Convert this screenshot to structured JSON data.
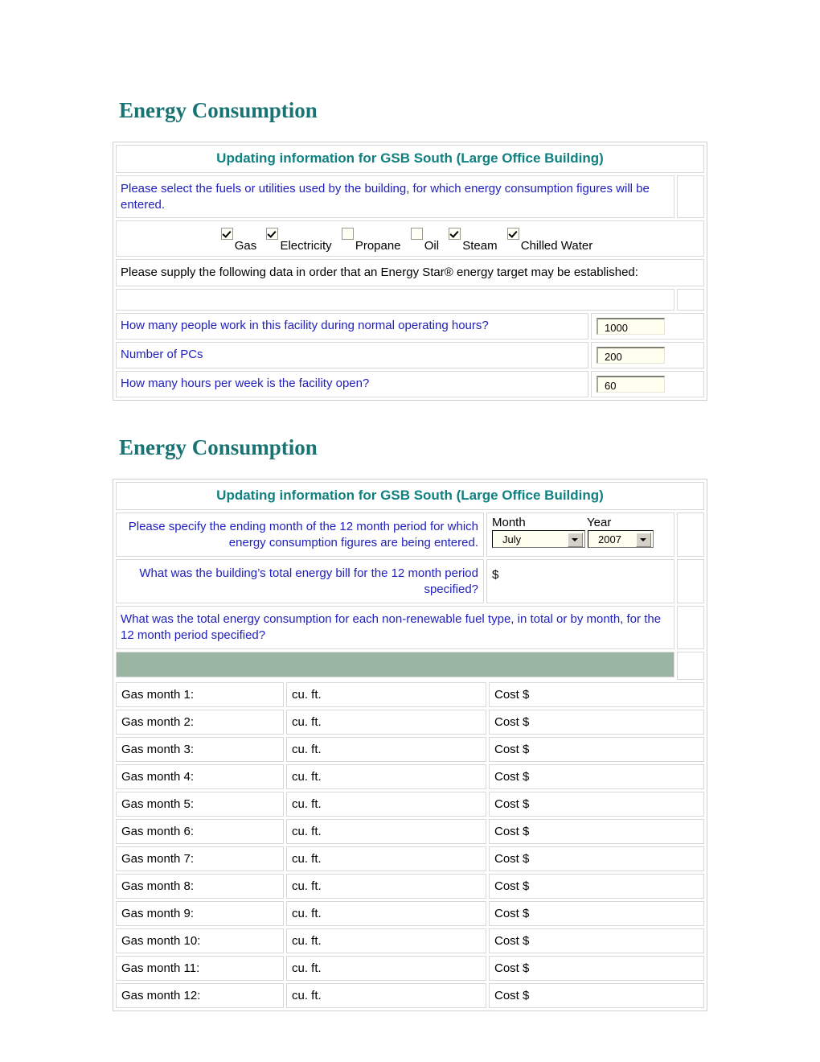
{
  "colors": {
    "heading_teal": "#1a7373",
    "panel_title_teal": "#118080",
    "prompt_blue": "#2020c0",
    "green_bar": "#9ab5a2",
    "input_bg": "#fffff0"
  },
  "section1": {
    "heading": "Energy Consumption",
    "panel_title": "Updating information for GSB South (Large Office Building)",
    "fuel_prompt": "Please select the fuels or utilities used by the building, for which energy consumption figures will be entered.",
    "fuels": [
      {
        "label": "Gas",
        "checked": true
      },
      {
        "label": "Electricity",
        "checked": true
      },
      {
        "label": "Propane",
        "checked": false
      },
      {
        "label": "Oil",
        "checked": false
      },
      {
        "label": "Steam",
        "checked": true
      },
      {
        "label": "Chilled Water",
        "checked": true
      }
    ],
    "supply_note": "Please supply the following data in order that an Energy Star® energy target may be established:",
    "fields": [
      {
        "label": "How many people work in this facility during normal operating hours?",
        "value": "1000"
      },
      {
        "label": "Number of PCs",
        "value": "200"
      },
      {
        "label": "How many hours per week is the facility open?",
        "value": "60"
      }
    ]
  },
  "section2": {
    "heading": "Energy Consumption",
    "panel_title": "Updating information for GSB South (Large Office Building)",
    "period_question": "Please specify the ending month of the 12 month period for which energy consumption figures are being entered.",
    "month_label": "Month",
    "year_label": "Year",
    "month_value": "July",
    "year_value": "2007",
    "bill_question": "What was the building’s total energy bill for the 12 month period specified?",
    "bill_prefix": "$",
    "bill_value": "",
    "consumption_note": "What was the total energy consumption for each non-renewable fuel type, in total or by month, for the 12 month period specified?",
    "gas_rows": [
      {
        "month": "Gas month 1:",
        "unit": "cu. ft.",
        "cost": "Cost $"
      },
      {
        "month": "Gas month 2:",
        "unit": "cu. ft.",
        "cost": "Cost $"
      },
      {
        "month": "Gas month 3:",
        "unit": "cu. ft.",
        "cost": "Cost $"
      },
      {
        "month": "Gas month 4:",
        "unit": "cu. ft.",
        "cost": "Cost $"
      },
      {
        "month": "Gas month 5:",
        "unit": "cu. ft.",
        "cost": "Cost $"
      },
      {
        "month": "Gas month 6:",
        "unit": "cu. ft.",
        "cost": "Cost $"
      },
      {
        "month": "Gas month 7:",
        "unit": "cu. ft.",
        "cost": "Cost $"
      },
      {
        "month": "Gas month 8:",
        "unit": "cu. ft.",
        "cost": "Cost $"
      },
      {
        "month": "Gas month 9:",
        "unit": "cu. ft.",
        "cost": "Cost $"
      },
      {
        "month": "Gas month 10:",
        "unit": "cu. ft.",
        "cost": "Cost $"
      },
      {
        "month": "Gas month 11:",
        "unit": "cu. ft.",
        "cost": "Cost $"
      },
      {
        "month": "Gas month 12:",
        "unit": "cu. ft.",
        "cost": "Cost $"
      }
    ]
  }
}
